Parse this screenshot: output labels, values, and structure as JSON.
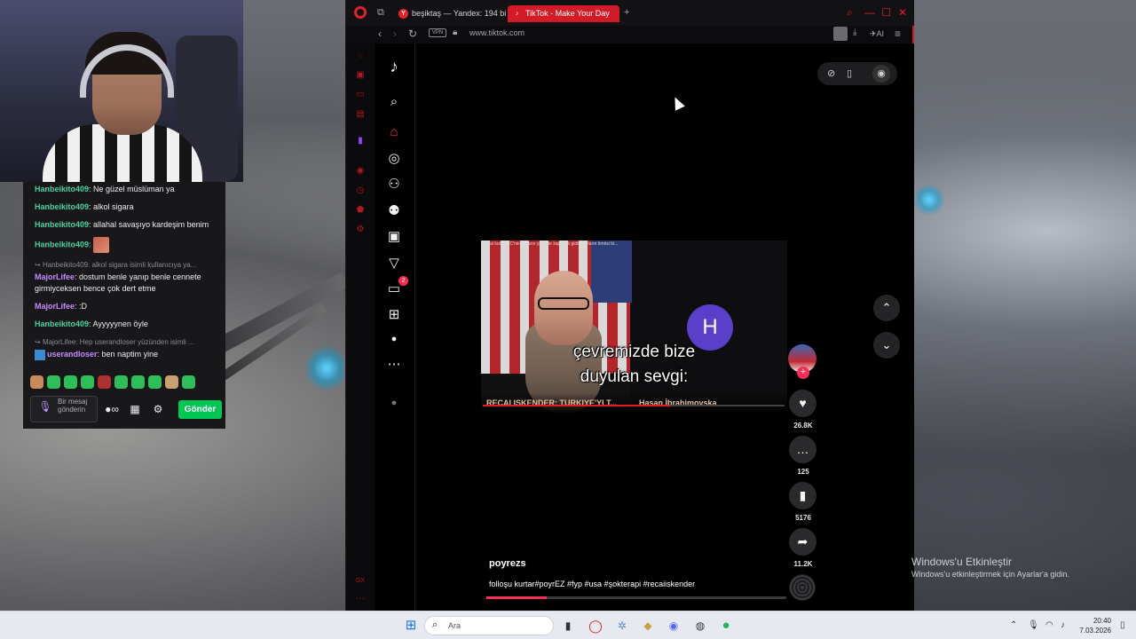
{
  "chat": {
    "messages": [
      {
        "user": "Hanbeikito409",
        "color": "green",
        "text": "Ne güzel müslüman ya"
      },
      {
        "user": "Hanbeikito409",
        "color": "green",
        "text": "alkol sigara"
      },
      {
        "user": "Hanbeikito409",
        "color": "green",
        "text": "allahal savaşıyo kardeşim benim"
      },
      {
        "user": "Hanbeikito409",
        "color": "green",
        "text": ""
      },
      {
        "reply": "Hanbeikito409: alkol sigara isimli kullanıcıya ya...",
        "user": "MajorLifee",
        "color": "purple",
        "text": "dostum benle yanıp benle cennete girmiyceksen bence çok dert etme"
      },
      {
        "user": "MajorLifee",
        "color": "purple",
        "text": ":D"
      },
      {
        "user": "Hanbeikito409",
        "color": "green",
        "text": "Ayyyyynen öyle"
      },
      {
        "reply": "MajorLifee: Hep userandloser yüzünden isimli ...",
        "user": "userandloser",
        "color": "purple",
        "text": "ben naptim yine"
      }
    ],
    "input_placeholder": "Bir mesaj gönderin",
    "send_label": "Gönder"
  },
  "browser": {
    "tabs": [
      {
        "label": "beşiktaş — Yandex: 194 bi",
        "favicon": "Y"
      },
      {
        "label": "TikTok - Make Your Day",
        "favicon": "♪"
      }
    ],
    "vpn_label": "VPN",
    "url": "www.tiktok.com",
    "ai_label": "AI"
  },
  "video": {
    "yt_top_text": "sanal kurtar TC'nin gizlarıe çok yüe zaplandı gidin kurtarın tirmisi bi...",
    "subtitle_line1": "çevremizde bize",
    "subtitle_line2": "duyulan sevgi:",
    "avatar_letter": "H",
    "yt_title_left": "RECAI ISKENDER: TURKIYE'YI T...",
    "yt_title_right": "Hasan İbrahimovska",
    "progress": 0.62
  },
  "post": {
    "author": "poyrezs",
    "caption": "folloşu kurtar#poyrEZ #fyp #usa #şokterapi #recaiiskender",
    "likes": "26.8K",
    "comments": "125",
    "saves": "5176",
    "shares": "11.2K",
    "progress": 0.2,
    "inbox_badge": "2"
  },
  "activation": {
    "title": "Windows'u Etkinleştir",
    "subtitle": "Windows'u etkinleştirmek için Ayarlar'a gidin."
  },
  "taskbar": {
    "search_placeholder": "Ara",
    "time": "20:40",
    "date": "7.03.2026"
  }
}
